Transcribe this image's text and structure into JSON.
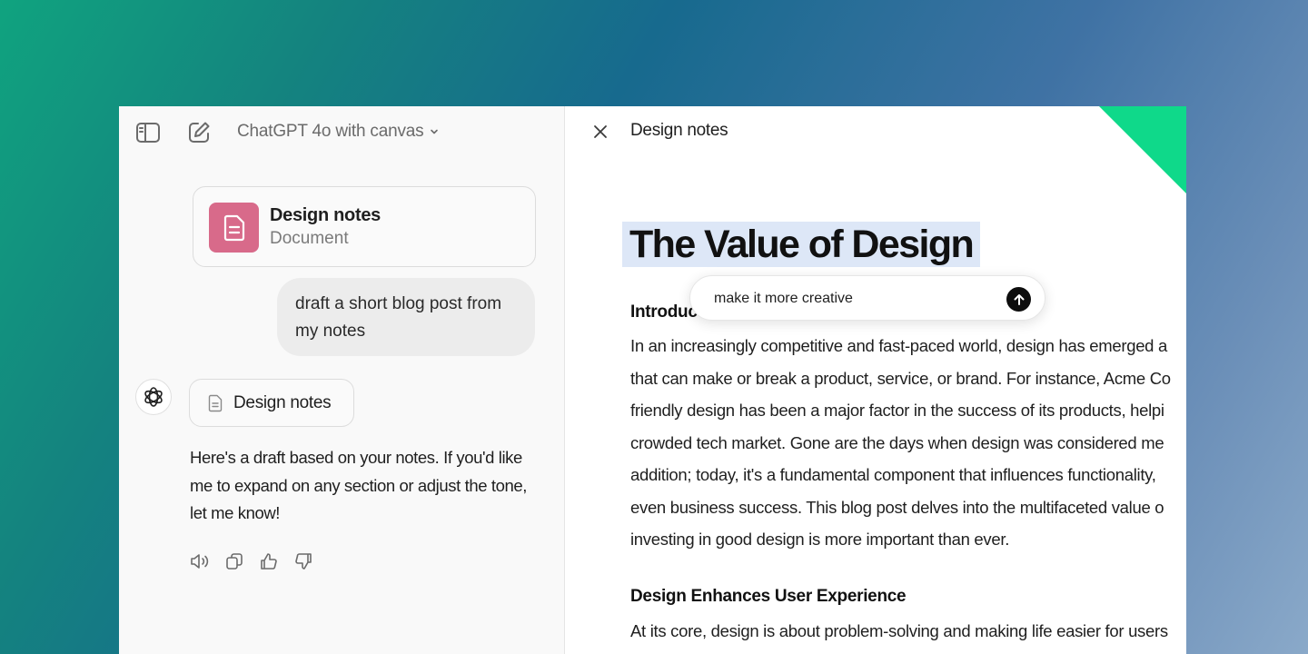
{
  "header": {
    "model_label": "ChatGPT 4o with canvas"
  },
  "conversation": {
    "doc_card": {
      "title": "Design notes",
      "subtitle": "Document"
    },
    "user_message": {
      "lines": [
        "draft a short blog post from",
        "my notes"
      ]
    },
    "assistant": {
      "doc_chip_label": "Design notes",
      "lines": [
        "Here's a draft based on your notes. If you'd like",
        "me to expand on any section or adjust the tone,",
        "let me know!"
      ]
    }
  },
  "canvas": {
    "title": "Design notes",
    "heading": "The Value of Design",
    "intro_heading": "Introduc",
    "intro_lines": [
      "In an increasingly competitive and fast-paced world, design has emerged a",
      "that can make or break a product, service, or brand. For instance, Acme Co",
      "friendly design has been a major factor in the success of its products, helpi",
      "crowded tech market. Gone are the days when design was considered me",
      "addition; today, it's a fundamental component that influences functionality,",
      "even business success. This blog post delves into the multifaceted value o",
      "investing in good design is more important than ever."
    ],
    "section2_heading": "Design Enhances User Experience",
    "section2_lines": [
      "At its core, design is about problem-solving and making life easier for users"
    ],
    "prompt": {
      "value": "make it more creative"
    }
  },
  "colors": {
    "doc_icon_bg": "#d86a8a",
    "highlight": "#dde7f7",
    "corner_accent": "#0fd98a"
  },
  "icons": {
    "sidebar_toggle": "sidebar-toggle-icon",
    "new_chat": "edit-icon",
    "model_chevron": "chevron-down-icon",
    "document": "document-icon",
    "assistant": "openai-logo-icon",
    "read_aloud": "speaker-icon",
    "copy": "copy-icon",
    "thumbs_up": "thumbs-up-icon",
    "thumbs_down": "thumbs-down-icon",
    "close": "close-icon",
    "send": "arrow-up-icon"
  }
}
